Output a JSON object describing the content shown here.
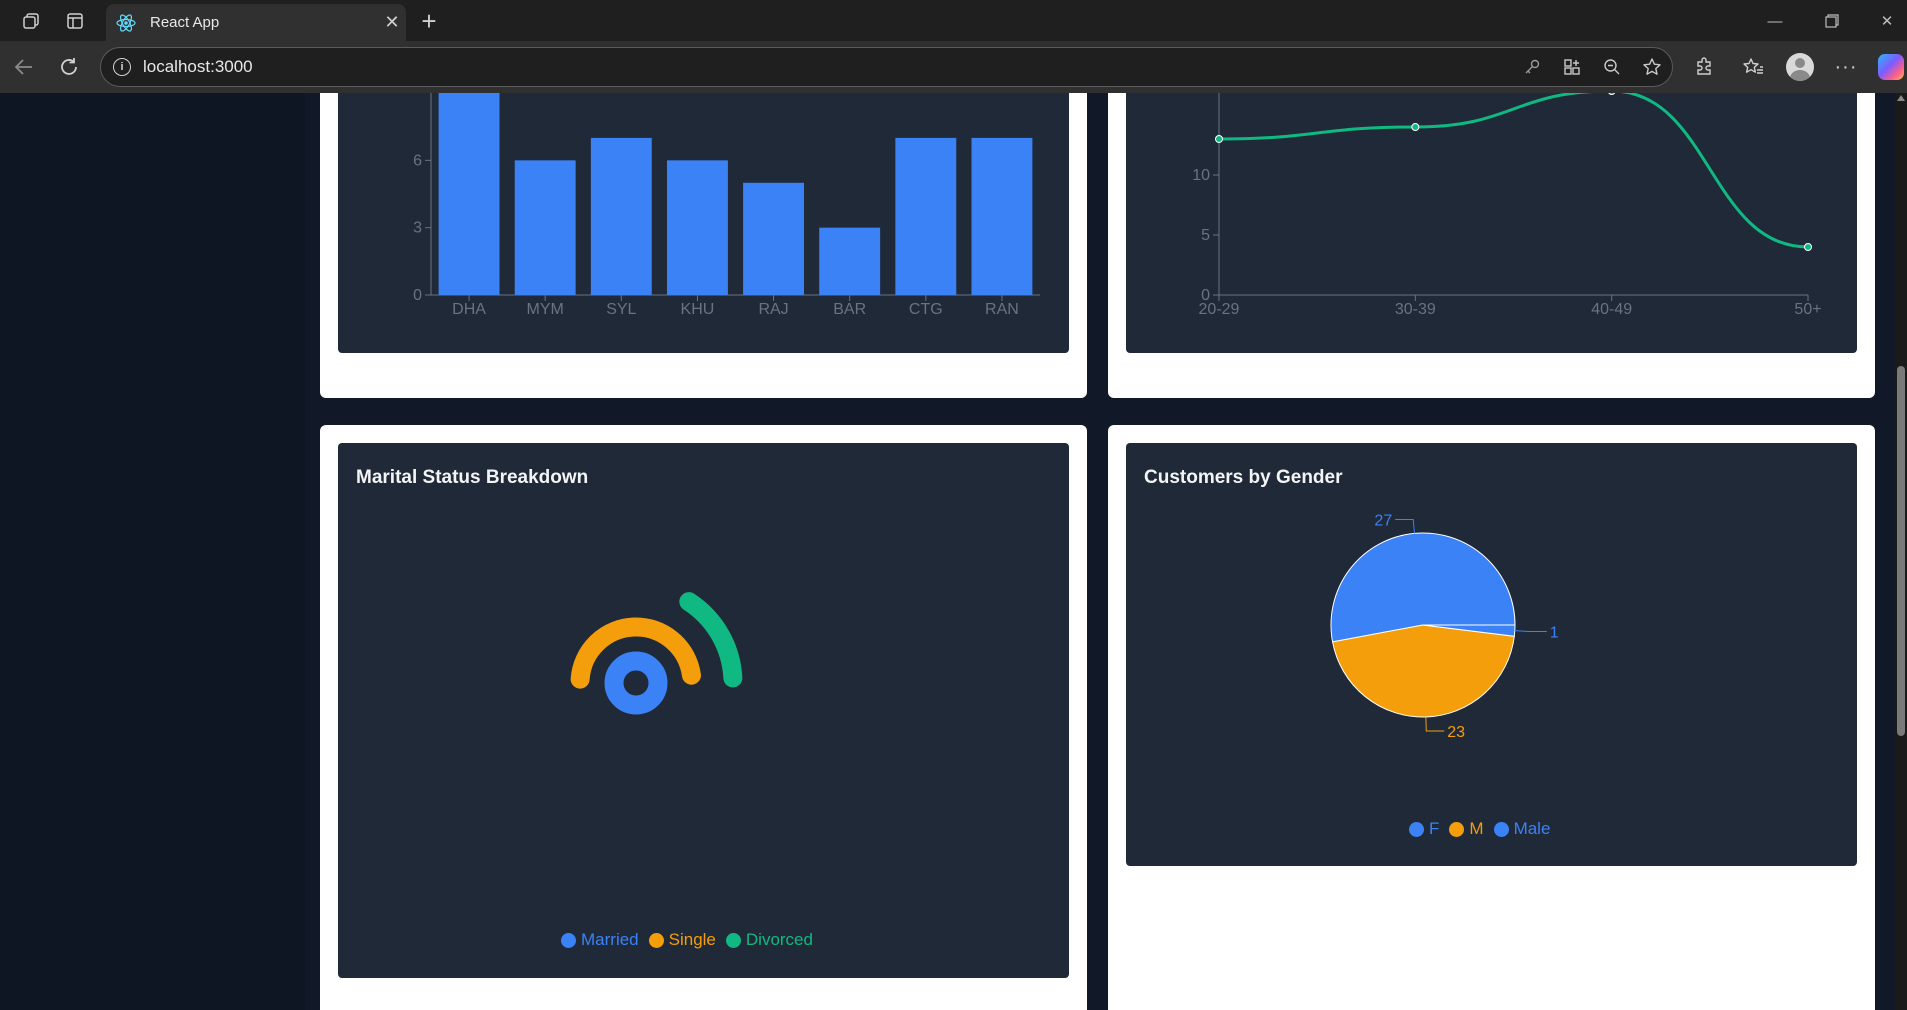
{
  "browser": {
    "tab_title": "React App",
    "url": "localhost:3000",
    "favicon": "react-logo-icon"
  },
  "colors": {
    "blue": "#3b82f6",
    "amber": "#f59e0b",
    "green": "#10b981",
    "panel": "#1f2937",
    "page": "#111827"
  },
  "charts": {
    "region_bar": {
      "chart_data": {
        "type": "bar",
        "categories": [
          "DHA",
          "MYM",
          "SYL",
          "KHU",
          "RAJ",
          "BAR",
          "CTG",
          "RAN"
        ],
        "values": [
          9,
          6,
          7,
          6,
          5,
          3,
          7,
          7
        ],
        "yticks": [
          "0",
          "3",
          "6"
        ],
        "ylim": [
          0,
          9
        ],
        "color": "#3b82f6"
      }
    },
    "age_line": {
      "chart_data": {
        "type": "line",
        "categories": [
          "20-29",
          "30-39",
          "40-49",
          "50+"
        ],
        "values": [
          13,
          14,
          17,
          4
        ],
        "yticks": [
          "0",
          "5",
          "10"
        ],
        "ylim": [
          0,
          16
        ],
        "color": "#10b981"
      }
    },
    "marital": {
      "title": "Marital Status Breakdown",
      "chart_data": {
        "type": "pie",
        "categories": [
          "Married",
          "Single",
          "Divorced"
        ],
        "colors": [
          "#3b82f6",
          "#f59e0b",
          "#10b981"
        ]
      }
    },
    "gender": {
      "title": "Customers by Gender",
      "chart_data": {
        "type": "pie",
        "categories": [
          "F",
          "M",
          "Male"
        ],
        "values": [
          27,
          23,
          1
        ],
        "labels": [
          "27",
          "23",
          "1"
        ],
        "colors": [
          "#3b82f6",
          "#f59e0b",
          "#3b82f6"
        ]
      }
    }
  }
}
